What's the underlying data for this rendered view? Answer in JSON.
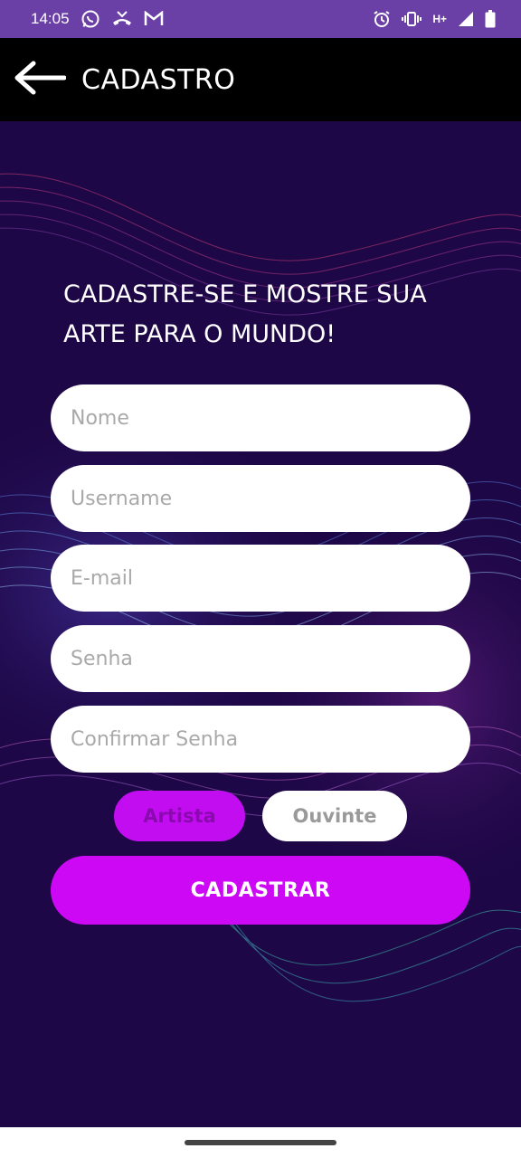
{
  "status_bar": {
    "time": "14:05",
    "network_label": "H+",
    "left_icons": [
      "whatsapp-icon",
      "missed-call-icon",
      "gmail-icon"
    ],
    "right_icons": [
      "alarm-icon",
      "vibrate-icon",
      "signal-icon",
      "battery-icon"
    ]
  },
  "app_bar": {
    "title": "CADASTRO",
    "back_icon": "arrow-left-icon"
  },
  "form": {
    "headline": "CADASTRE-SE E MOSTRE SUA ARTE PARA O MUNDO!",
    "fields": {
      "name_placeholder": "Nome",
      "username_placeholder": "Username",
      "email_placeholder": "E-mail",
      "password_placeholder": "Senha",
      "confirm_password_placeholder": "Confirmar Senha"
    },
    "user_type": {
      "artist_label": "Artista",
      "listener_label": "Ouvinte",
      "selected": "Artista"
    },
    "submit_label": "CADASTRAR"
  },
  "colors": {
    "status_bar": "#6a3fa6",
    "app_bar": "#000000",
    "background": "#1d0746",
    "accent": "#cc08f5"
  }
}
